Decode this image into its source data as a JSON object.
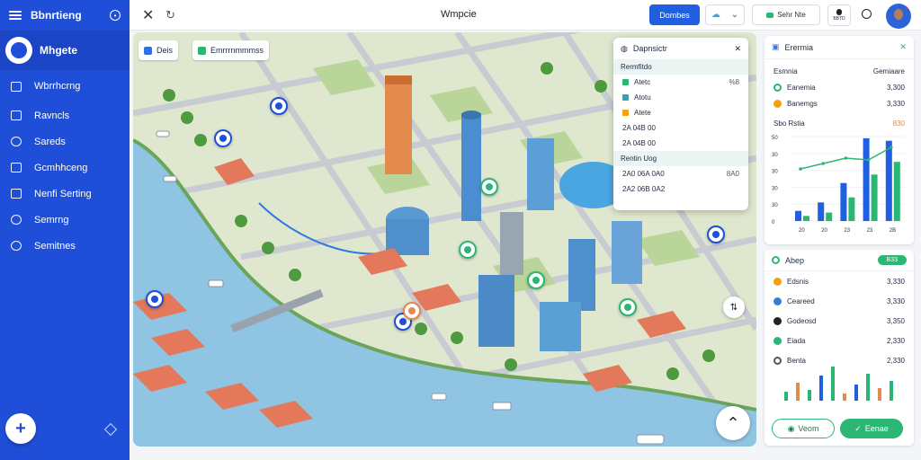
{
  "app": {
    "title": "Bbnrtieng",
    "window_title": "Wmpcie"
  },
  "sidebar": {
    "user_name": "Mhgete",
    "items": [
      {
        "label": "Wbrrhcrng",
        "icon": "edit-icon"
      },
      {
        "label": "Ravncls",
        "icon": "list-icon"
      },
      {
        "label": "Sareds",
        "icon": "globe-icon"
      },
      {
        "label": "Gcmhhceng",
        "icon": "monitor-icon"
      },
      {
        "label": "Nenfi Serting",
        "icon": "paper-plane-icon"
      },
      {
        "label": "Semrng",
        "icon": "gauge-icon"
      },
      {
        "label": "Semitnes",
        "icon": "network-icon"
      }
    ],
    "fab_label": "+"
  },
  "topbar": {
    "primary_button": "Dombes",
    "status_button": "Sehr Nte",
    "user_chip": "BBTD"
  },
  "map": {
    "tabs": [
      {
        "label": "Deis",
        "color": "#2f6fe0"
      },
      {
        "label": "Emrrrnmmmss",
        "color": "#2bb673"
      }
    ]
  },
  "layer_popup": {
    "title": "Dapnsictr",
    "section1": "Rermfitdo",
    "rows": [
      {
        "label": "Atetc",
        "value": "%8",
        "color": "#2bb673"
      },
      {
        "label": "Atotu",
        "value": "",
        "color": "#3aa0b0"
      },
      {
        "label": "Atete",
        "value": "",
        "color": "#f2a20d"
      },
      {
        "label": "2A 04B 00",
        "value": "",
        "color": ""
      },
      {
        "label": "2A 04B 00",
        "value": "",
        "color": ""
      }
    ],
    "section2": "Rentin Uog",
    "section2_rows": [
      {
        "label": "2A0 06A 0A0",
        "value": "8A0"
      },
      {
        "label": "2A2 06B 0A2",
        "value": ""
      }
    ]
  },
  "panel_top": {
    "title": "Erermia",
    "col_label": "Esmnia",
    "col_value": "Gemiaare",
    "rows": [
      {
        "label": "Eanemia",
        "value": "3,300",
        "color": "#2bb673"
      },
      {
        "label": "Banemgs",
        "value": "3,330",
        "color": "#f2a20d"
      }
    ],
    "chart_title": "Sbo Rstia",
    "chart_badge": "830",
    "chart_data": {
      "type": "bar",
      "categories": [
        "20",
        "20",
        "23",
        "23",
        "2B"
      ],
      "series": [
        {
          "name": "",
          "values": [
            12,
            22,
            45,
            98,
            95
          ]
        },
        {
          "name": "",
          "values": [
            6,
            10,
            28,
            55,
            70
          ]
        }
      ],
      "line": [
        18,
        24,
        30,
        28,
        42
      ],
      "yticks": [
        "50",
        "30",
        "30",
        "30",
        "30",
        "0"
      ]
    }
  },
  "panel_bottom": {
    "title": "Abep",
    "badge": "B33",
    "rows": [
      {
        "label": "Edsnis",
        "value": "3,330",
        "color": "#f2a20d"
      },
      {
        "label": "Ceareed",
        "value": "3,330",
        "color": "#3a7bd5"
      },
      {
        "label": "Godeosd",
        "value": "3,350",
        "color": "#222222"
      },
      {
        "label": "Eiada",
        "value": "2,330",
        "color": "#2bb673"
      },
      {
        "label": "Benta",
        "value": "2,330",
        "color": "#555555"
      }
    ],
    "mini_bars": [
      10,
      20,
      12,
      28,
      38,
      8,
      18,
      30,
      14,
      22
    ],
    "button_outline": "Veom",
    "button_fill": "Eenae"
  }
}
